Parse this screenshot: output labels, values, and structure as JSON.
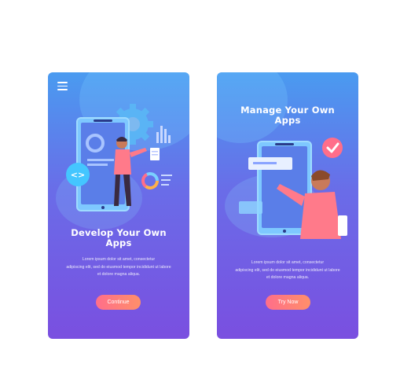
{
  "screens": [
    {
      "title_line1": "Develop Your Own",
      "title_line2": "Apps",
      "body_lines": [
        "Lorem ipsum dolor sit amet, consectetur",
        "adipiscing elit, sed do eiusmod tempor incididunt ut labore",
        "et dolore magna aliqua."
      ],
      "button_label": "Continue",
      "icons": [
        "menu-icon",
        "gear-icon",
        "code-icon",
        "bar-chart-icon",
        "donut-chart-icon",
        "document-icon"
      ]
    },
    {
      "title_line1": "Manage Your Own",
      "title_line2": "Apps",
      "body_lines": [
        "Lorem ipsum dolor sit amet, consectetur",
        "adipiscing elit, sed do eiusmod tempor incididunt ut labore",
        "et dolore magna aliqua."
      ],
      "button_label": "Try Now",
      "icons": [
        "checkmark-icon"
      ]
    }
  ],
  "colors": {
    "gradient_top": "#4a9bf0",
    "gradient_bottom": "#7a4fe0",
    "button": "#ff7a7a",
    "accent_pink": "#ff6e8a"
  }
}
